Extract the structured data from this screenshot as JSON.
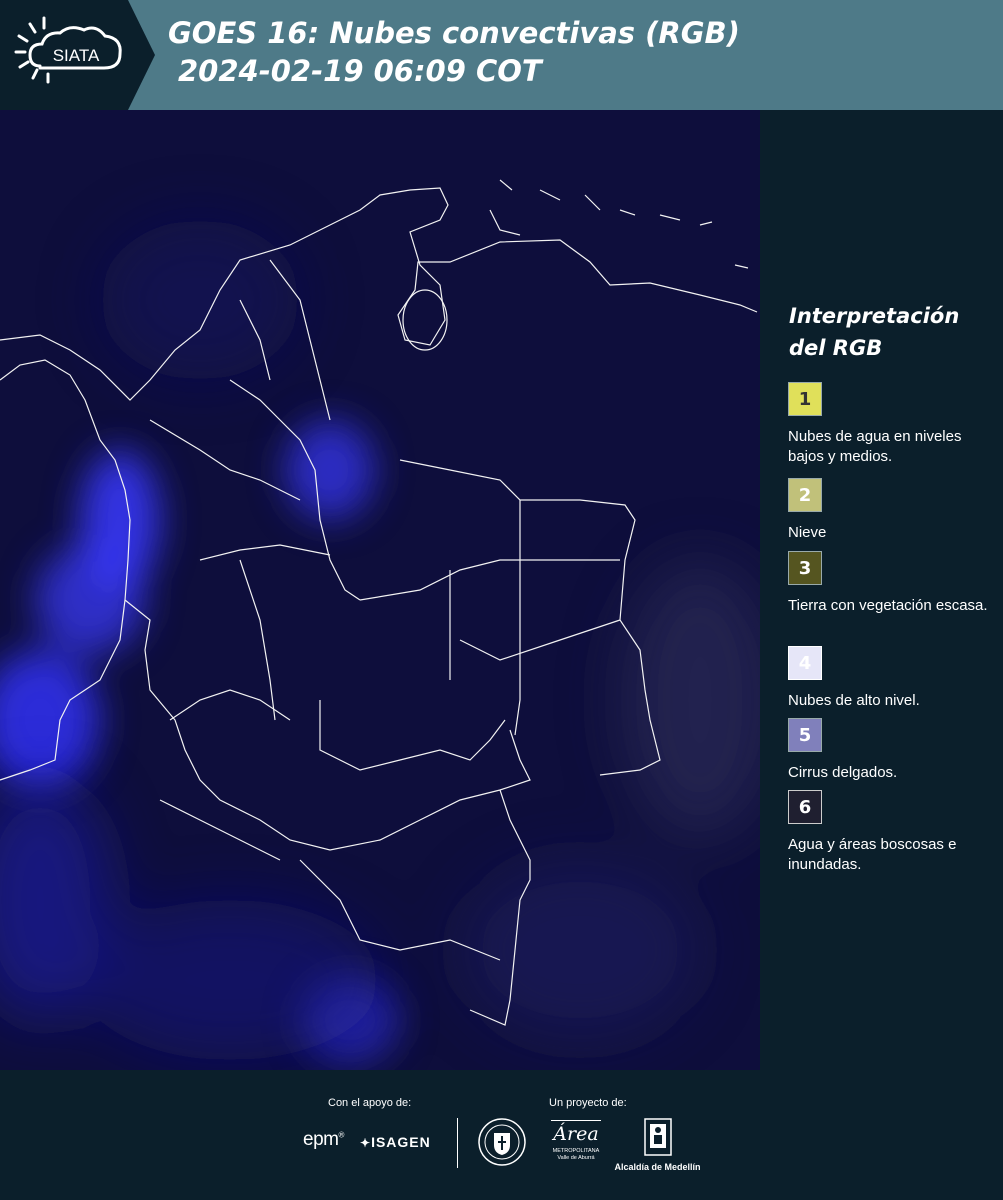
{
  "header": {
    "logo_text": "SIATA",
    "title_line1": "GOES 16: Nubes convectivas (RGB)",
    "title_line2": "2024-02-19 06:09 COT"
  },
  "legend": {
    "title": "Interpretación del RGB",
    "items": [
      {
        "number": "1",
        "label": "Nubes de agua en niveles bajos y medios.",
        "color": "#e0e05a"
      },
      {
        "number": "2",
        "label": "Nieve",
        "color": "#c1c17a"
      },
      {
        "number": "3",
        "label": "Tierra con vegetación escasa.",
        "color": "#555520"
      },
      {
        "number": "4",
        "label": "Nubes de alto nivel.",
        "color": "#e6e6f8"
      },
      {
        "number": "5",
        "label": "Cirrus delgados.",
        "color": "#8080bb"
      },
      {
        "number": "6",
        "label": "Agua y áreas boscosas e inundadas.",
        "color": "#1f1f30"
      }
    ]
  },
  "footer": {
    "support_label": "Con el apoyo de:",
    "project_label": "Un proyecto de:",
    "logos": {
      "epm": "epm",
      "isagen": "ISAGEN",
      "area_name": "Área",
      "area_sub1": "METROPOLITANA",
      "area_sub2": "Valle de Aburrá",
      "alcaldia": "Alcaldía de Medellín"
    }
  },
  "colors": {
    "header_bg": "#4e7a88",
    "logo_panel_bg": "#0b1f2b",
    "page_bg": "#0b1f2b",
    "map_bg": "#0d0d38",
    "cloud_blue": "#3a3aff"
  }
}
